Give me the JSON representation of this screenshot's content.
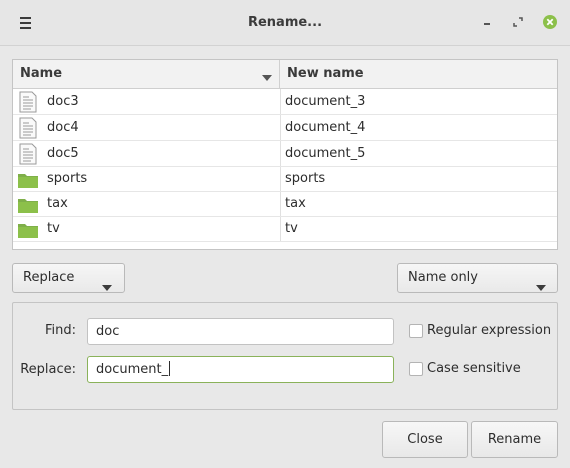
{
  "window": {
    "title": "Rename..."
  },
  "colors": {
    "accent_green": "#8cc04a",
    "folder_green": "#7faf4a",
    "focus_border": "#8ab25a"
  },
  "list": {
    "columns": [
      "Name",
      "New name"
    ],
    "sort_indicator": "chevron-down-icon",
    "rows": [
      {
        "icon": "document-icon",
        "name": "doc3",
        "new_name": "document_3"
      },
      {
        "icon": "document-icon",
        "name": "doc4",
        "new_name": "document_4"
      },
      {
        "icon": "document-icon",
        "name": "doc5",
        "new_name": "document_5"
      },
      {
        "icon": "folder-icon",
        "name": "sports",
        "new_name": "sports"
      },
      {
        "icon": "folder-icon",
        "name": "tax",
        "new_name": "tax"
      },
      {
        "icon": "folder-icon",
        "name": "tv",
        "new_name": "tv"
      }
    ]
  },
  "options": {
    "mode": "Replace",
    "scope": "Name only"
  },
  "find_replace": {
    "find_label": "Find:",
    "find_value": "doc",
    "replace_label": "Replace:",
    "replace_value": "document_",
    "regex_label": "Regular expression",
    "regex_checked": false,
    "case_label": "Case sensitive",
    "case_checked": false
  },
  "actions": {
    "close_label": "Close",
    "rename_label": "Rename"
  }
}
